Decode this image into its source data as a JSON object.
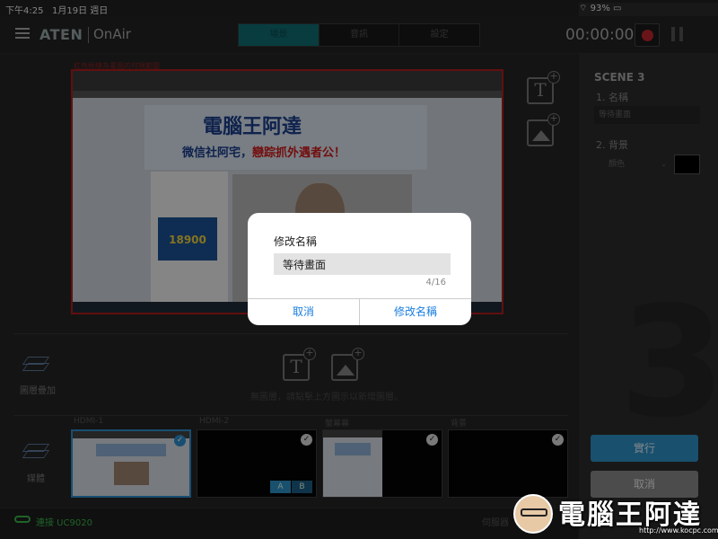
{
  "status_bar": {
    "time": "下午4:25",
    "date": "1月19日 週日",
    "battery": "93%"
  },
  "header": {
    "logo": "ATEN",
    "product": "OnAir",
    "tabs": [
      {
        "label": "場景"
      },
      {
        "label": "音訊"
      },
      {
        "label": "設定"
      }
    ],
    "timer": "00:00:00"
  },
  "canvas": {
    "warning": "紅色框線為畫面的可視範圍",
    "preview_site_title": "電腦王阿達",
    "preview_site_subtitle": "微信社阿宅，",
    "preview_site_highlight": "戀踪抓外遇者公！",
    "preview_ad_number": "18900"
  },
  "layers": {
    "label": "圖層疊加",
    "hint": "無圖層，請點擊上方圖示以新增圖層。"
  },
  "sources": {
    "label": "媒體",
    "items": [
      {
        "name": "HDMI-1"
      },
      {
        "name": "HDMI-2"
      },
      {
        "name": "螢幕幕"
      },
      {
        "name": "背景"
      }
    ],
    "ab": [
      "A",
      "B"
    ]
  },
  "footer": {
    "connection": "連接 UC9020",
    "server": "伺服器"
  },
  "scene_panel": {
    "title": "SCENE 3",
    "name_label": "1. 名稱",
    "name_value": "等待畫面",
    "bg_label": "2. 背景",
    "bg_type": "顏色",
    "bg_color": "#000000",
    "big_number": "3",
    "run_label": "實行",
    "cancel_label": "取消"
  },
  "dialog": {
    "title": "修改名稱",
    "value": "等待畫面",
    "count": "4/16",
    "cancel": "取消",
    "confirm": "修改名稱"
  },
  "watermark": {
    "text": "電腦王阿達",
    "url": "http://www.kocpc.com.tw"
  },
  "colors": {
    "accent": "#2f93c8",
    "record": "#c0262d",
    "connected": "#39b54a",
    "frame": "#b11d1d"
  }
}
